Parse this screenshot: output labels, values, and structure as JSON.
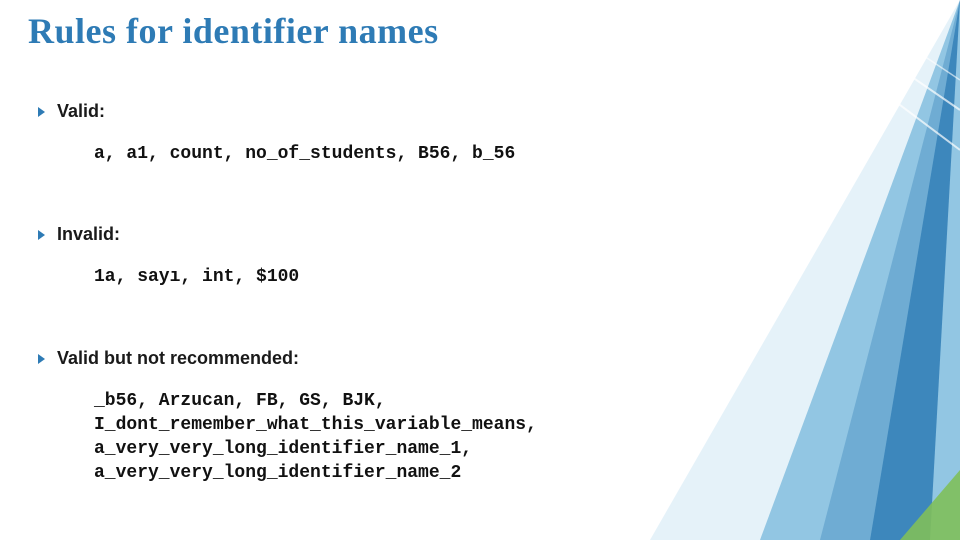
{
  "title": "Rules for identifier names",
  "sections": [
    {
      "label": "Valid:",
      "code": "a, a1, count, no_of_students, B56, b_56"
    },
    {
      "label": "Invalid:",
      "code": "1a, sayı, int, $100"
    },
    {
      "label": "Valid but not recommended:",
      "code": "_b56, Arzucan, FB, GS, BJK,\nI_dont_remember_what_this_variable_means,\na_very_very_long_identifier_name_1,\na_very_very_long_identifier_name_2"
    }
  ],
  "theme": {
    "accent": "#2e7bb5",
    "accent_light": "#6db7dd",
    "accent_pale": "#cfe8f4",
    "green": "#7fbf5a"
  }
}
